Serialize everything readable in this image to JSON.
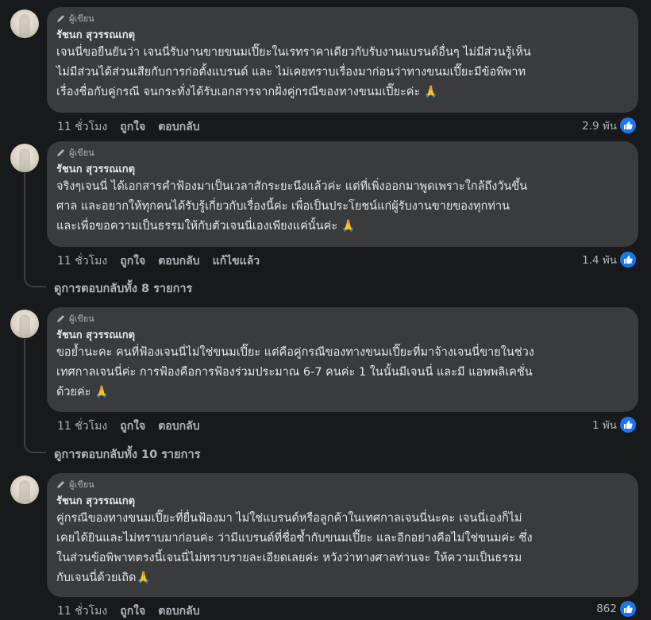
{
  "comments": [
    {
      "badge": "ผู้เขียน",
      "author": "รัชนก สุวรรณเกตุ",
      "lines": [
        "เจนนี่ขอยืนยันว่า เจนนี่รับงานขายขนมเปี๊ยะในเรทราคาเดียวกับรับงานแบรนด์อื่นๆ ไม่มีส่วนรู้เห็น",
        "ไม่มีส่วนได้ส่วนเสียกับการก่อตั้งแบรนด์ และ ไม่เคยทราบเรื่องมาก่อนว่าทางขนมเปี๊ยะมีข้อพิพาท",
        "เรื่องชื่อกับคู่กรณี จนกระทั่งได้รับเอกสารจากฝั่งคู่กรณีของทางขนมเปี๊ยะค่ะ 🙏"
      ],
      "time": "11 ชั่วโมง",
      "like": "ถูกใจ",
      "reply": "ตอบกลับ",
      "edited": "",
      "count": "2.9 พัน"
    },
    {
      "badge": "ผู้เขียน",
      "author": "รัชนก สุวรรณเกตุ",
      "lines": [
        "จริงๆเจนนี่ ได้เอกสารคำฟ้องมาเป็นเวลาสักระยะนึงแล้วค่ะ แต่ที่เพิ่งออกมาพูดเพราะใกล้ถึงวันขึ้น",
        "ศาล และอยากให้ทุกคนได้รับรู้เกี่ยวกับเรื่องนี้ค่ะ เพื่อเป็นประโยชน์แก่ผู้รับงานขายของทุกท่าน",
        "และเพื่อขอความเป็นธรรมให้กับตัวเจนนี่เองเพียงแค่นั้นค่ะ 🙏"
      ],
      "time": "11 ชั่วโมง",
      "like": "ถูกใจ",
      "reply": "ตอบกลับ",
      "edited": "แก้ไขแล้ว",
      "count": "1.4 พัน"
    },
    {
      "badge": "ผู้เขียน",
      "author": "รัชนก สุวรรณเกตุ",
      "lines": [
        "ขอย้ำนะคะ คนที่ฟ้องเจนนี่ไม่ใช่ขนมเปี๊ยะ แต่คือคู่กรณีของทางขนมเปี๊ยะที่มาจ้างเจนนี่ขายในช่วง",
        "เทศกาลเจนนี่ค่ะ การฟ้องคือการฟ้องร่วมประมาณ 6-7 คนค่ะ 1 ในนั้นมีเจนนี่ และมี แอพพลิเคชั่น",
        "ด้วยค่ะ 🙏"
      ],
      "time": "11 ชั่วโมง",
      "like": "ถูกใจ",
      "reply": "ตอบกลับ",
      "edited": "",
      "count": "1 พัน"
    },
    {
      "badge": "ผู้เขียน",
      "author": "รัชนก สุวรรณเกตุ",
      "lines": [
        "คู่กรณีของทางขนมเปี๊ยะที่ยื่นฟ้องมา ไม่ใช่แบรนด์หรือลูกค้าในเทศกาลเจนนี่นะคะ เจนนี่เองก็ไม่",
        "เคยได้ยินและไม่ทราบมาก่อนค่ะ ว่ามีแบรนด์ที่ชื่อซ้ำกับขนมเปี๊ยะ และอีกอย่างคือไม่ใช่ขนมค่ะ ซึ่ง",
        "ในส่วนข้อพิพาทตรงนี้เจนนี่ไม่ทราบรายละเอียดเลยค่ะ หวังว่าทางศาลท่านจะ ให้ความเป็นธรรม",
        "กับเจนนี่ด้วยเถิด🙏"
      ],
      "time": "11 ชั่วโมง",
      "like": "ถูกใจ",
      "reply": "ตอบกลับ",
      "edited": "",
      "count": "862"
    }
  ],
  "view_replies": [
    "ดูการตอบกลับทั้ง 8 รายการ",
    "ดูการตอบกลับทั้ง 10 รายการ"
  ],
  "colors": {
    "background": "#18191a",
    "bubble": "#3a3b3c",
    "like": "#1877f2"
  }
}
